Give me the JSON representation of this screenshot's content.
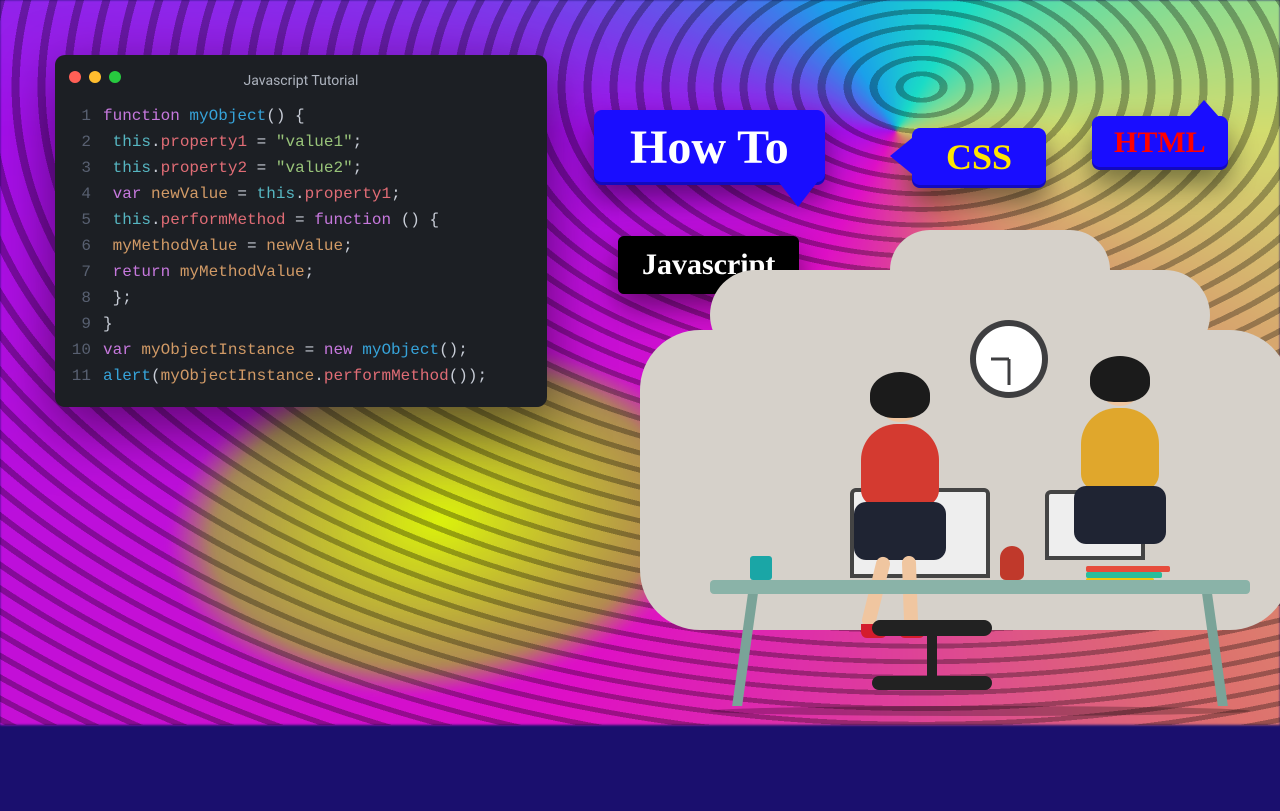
{
  "editor": {
    "title": "Javascript Tutorial",
    "lines": [
      {
        "n": "1",
        "parts": [
          {
            "c": "kw",
            "t": "function "
          },
          {
            "c": "fn",
            "t": "myObject"
          },
          {
            "c": "pun",
            "t": "() {"
          }
        ]
      },
      {
        "n": "2",
        "parts": [
          {
            "c": "",
            "t": "   "
          },
          {
            "c": "this",
            "t": "this"
          },
          {
            "c": "pun",
            "t": "."
          },
          {
            "c": "id",
            "t": "property1"
          },
          {
            "c": "op",
            "t": " = "
          },
          {
            "c": "str",
            "t": "\"value1\""
          },
          {
            "c": "pun",
            "t": ";"
          }
        ]
      },
      {
        "n": "3",
        "parts": [
          {
            "c": "",
            "t": "   "
          },
          {
            "c": "this",
            "t": "this"
          },
          {
            "c": "pun",
            "t": "."
          },
          {
            "c": "id",
            "t": "property2"
          },
          {
            "c": "op",
            "t": " = "
          },
          {
            "c": "str",
            "t": "\"value2\""
          },
          {
            "c": "pun",
            "t": ";"
          }
        ]
      },
      {
        "n": "4",
        "parts": [
          {
            "c": "",
            "t": "   "
          },
          {
            "c": "kw",
            "t": "var "
          },
          {
            "c": "var",
            "t": "newValue"
          },
          {
            "c": "op",
            "t": " = "
          },
          {
            "c": "this",
            "t": "this"
          },
          {
            "c": "pun",
            "t": "."
          },
          {
            "c": "id",
            "t": "property1"
          },
          {
            "c": "pun",
            "t": ";"
          }
        ]
      },
      {
        "n": "5",
        "parts": [
          {
            "c": "",
            "t": "   "
          },
          {
            "c": "this",
            "t": "this"
          },
          {
            "c": "pun",
            "t": "."
          },
          {
            "c": "id",
            "t": "performMethod"
          },
          {
            "c": "op",
            "t": " = "
          },
          {
            "c": "kw",
            "t": "function "
          },
          {
            "c": "pun",
            "t": "() {"
          }
        ]
      },
      {
        "n": "6",
        "parts": [
          {
            "c": "",
            "t": "      "
          },
          {
            "c": "var",
            "t": "myMethodValue"
          },
          {
            "c": "op",
            "t": " = "
          },
          {
            "c": "var",
            "t": "newValue"
          },
          {
            "c": "pun",
            "t": ";"
          }
        ]
      },
      {
        "n": "7",
        "parts": [
          {
            "c": "",
            "t": "      "
          },
          {
            "c": "kw",
            "t": "return "
          },
          {
            "c": "var",
            "t": "myMethodValue"
          },
          {
            "c": "pun",
            "t": ";"
          }
        ]
      },
      {
        "n": "8",
        "parts": [
          {
            "c": "",
            "t": "   "
          },
          {
            "c": "pun",
            "t": "};"
          }
        ]
      },
      {
        "n": "9",
        "parts": [
          {
            "c": "pun",
            "t": "}"
          }
        ]
      },
      {
        "n": "10",
        "parts": [
          {
            "c": "kw",
            "t": "var "
          },
          {
            "c": "var",
            "t": "myObjectInstance"
          },
          {
            "c": "op",
            "t": " = "
          },
          {
            "c": "kw",
            "t": "new "
          },
          {
            "c": "fn",
            "t": "myObject"
          },
          {
            "c": "pun",
            "t": "();"
          }
        ]
      },
      {
        "n": "11",
        "parts": [
          {
            "c": "fn",
            "t": "alert"
          },
          {
            "c": "pun",
            "t": "("
          },
          {
            "c": "var",
            "t": "myObjectInstance"
          },
          {
            "c": "pun",
            "t": "."
          },
          {
            "c": "id",
            "t": "performMethod"
          },
          {
            "c": "pun",
            "t": "());"
          }
        ]
      }
    ]
  },
  "callouts": {
    "howto": "How To",
    "css": "CSS",
    "html": "HTML",
    "javascript": "Javascript"
  }
}
